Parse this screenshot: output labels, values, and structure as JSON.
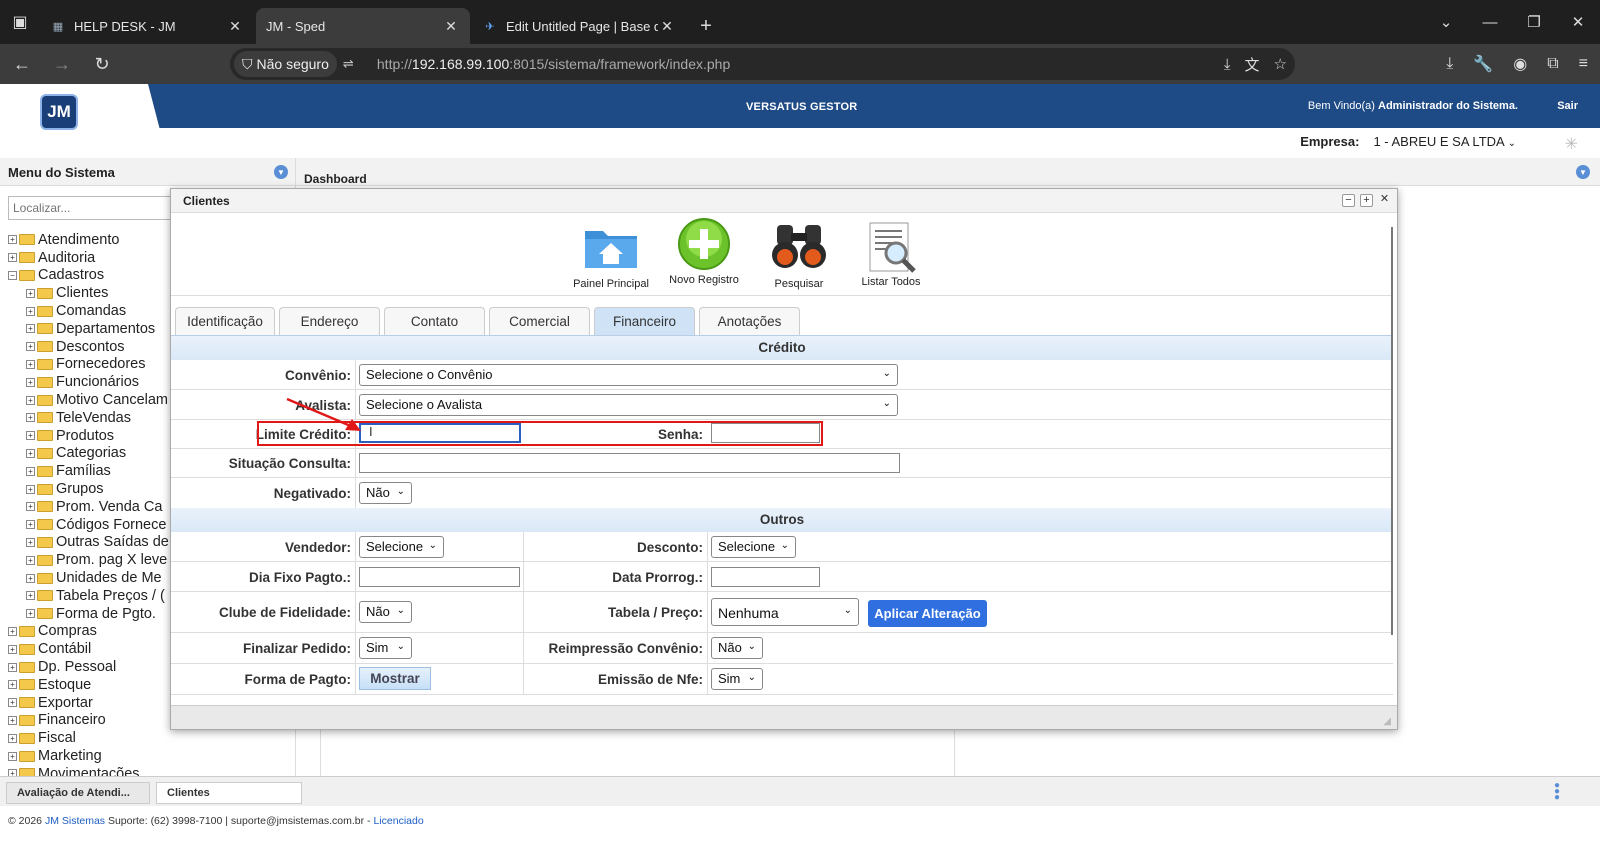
{
  "browser": {
    "tabs": [
      {
        "title": "HELP DESK - JM",
        "active": false
      },
      {
        "title": "JM - Sped",
        "active": true
      },
      {
        "title": "Edit Untitled Page | Base de Co",
        "active": false
      }
    ],
    "security_label": "Não seguro",
    "url_prefix": "http://",
    "url_host": "192.168.99.100",
    "url_rest": ":8015/sistema/framework/index.php"
  },
  "app": {
    "logo": "JM",
    "title": "VERSATUS GESTOR",
    "welcome_prefix": "Bem Vindo(a)",
    "welcome_user": "Administrador do Sistema.",
    "logout": "Sair",
    "company_label": "Empresa:",
    "company_value": "1 - ABREU E SA LTDA"
  },
  "menu": {
    "title": "Menu do Sistema",
    "search_placeholder": "Localizar...",
    "items": [
      {
        "label": "Atendimento",
        "level": 1,
        "sign": "+"
      },
      {
        "label": "Auditoria",
        "level": 1,
        "sign": "+"
      },
      {
        "label": "Cadastros",
        "level": 1,
        "sign": "−"
      },
      {
        "label": "Clientes",
        "level": 2,
        "sign": "+"
      },
      {
        "label": "Comandas",
        "level": 2,
        "sign": "+"
      },
      {
        "label": "Departamentos",
        "level": 2,
        "sign": "+"
      },
      {
        "label": "Descontos",
        "level": 2,
        "sign": "+"
      },
      {
        "label": "Fornecedores",
        "level": 2,
        "sign": "+"
      },
      {
        "label": "Funcionários",
        "level": 2,
        "sign": "+"
      },
      {
        "label": "Motivo Cancelam",
        "level": 2,
        "sign": "+"
      },
      {
        "label": "TeleVendas",
        "level": 2,
        "sign": "+"
      },
      {
        "label": "Produtos",
        "level": 2,
        "sign": "+"
      },
      {
        "label": "Categorias",
        "level": 2,
        "sign": "+"
      },
      {
        "label": "Famílias",
        "level": 2,
        "sign": "+"
      },
      {
        "label": "Grupos",
        "level": 2,
        "sign": "+"
      },
      {
        "label": "Prom. Venda Ca",
        "level": 2,
        "sign": "+"
      },
      {
        "label": "Códigos Fornece",
        "level": 2,
        "sign": "+"
      },
      {
        "label": "Outras Saídas de",
        "level": 2,
        "sign": "+"
      },
      {
        "label": "Prom. pag X leve",
        "level": 2,
        "sign": "+"
      },
      {
        "label": "Unidades de Me",
        "level": 2,
        "sign": "+"
      },
      {
        "label": "Tabela Preços / (",
        "level": 2,
        "sign": "+"
      },
      {
        "label": "Forma de Pgto.",
        "level": 2,
        "sign": "+"
      },
      {
        "label": "Compras",
        "level": 1,
        "sign": "+"
      },
      {
        "label": "Contábil",
        "level": 1,
        "sign": "+"
      },
      {
        "label": "Dp. Pessoal",
        "level": 1,
        "sign": "+"
      },
      {
        "label": "Estoque",
        "level": 1,
        "sign": "+"
      },
      {
        "label": "Exportar",
        "level": 1,
        "sign": "+"
      },
      {
        "label": "Financeiro",
        "level": 1,
        "sign": "+"
      },
      {
        "label": "Fiscal",
        "level": 1,
        "sign": "+"
      },
      {
        "label": "Marketing",
        "level": 1,
        "sign": "+"
      },
      {
        "label": "Movimentações",
        "level": 1,
        "sign": "+"
      }
    ]
  },
  "dashboard": {
    "title": "Dashboard"
  },
  "window": {
    "title": "Clientes",
    "toolbar": {
      "home": "Painel Principal",
      "new": "Novo Registro",
      "search": "Pesquisar",
      "list": "Listar Todos"
    },
    "tabs": [
      "Identificação",
      "Endereço",
      "Contato",
      "Comercial",
      "Financeiro",
      "Anotações"
    ],
    "active_tab": "Financeiro",
    "credito": {
      "title": "Crédito",
      "convenio_label": "Convênio:",
      "convenio_value": "Selecione o Convênio",
      "avalista_label": "Avalista:",
      "avalista_value": "Selecione o Avalista",
      "limite_label": "Limite Crédito:",
      "senha_label": "Senha:",
      "situacao_label": "Situação Consulta:",
      "negativado_label": "Negativado:",
      "negativado_value": "Não"
    },
    "outros": {
      "title": "Outros",
      "vendedor_label": "Vendedor:",
      "vendedor_value": "Selecione",
      "desconto_label": "Desconto:",
      "desconto_value": "Selecione",
      "diafixo_label": "Dia Fixo Pagto.:",
      "prorrog_label": "Data Prorrog.:",
      "clube_label": "Clube de Fidelidade:",
      "clube_value": "Não",
      "tabela_label": "Tabela / Preço:",
      "tabela_value": "Nenhuma",
      "aplicar_label": "Aplicar Alteração",
      "finalizar_label": "Finalizar Pedido:",
      "finalizar_value": "Sim",
      "reimp_label": "Reimpressão Convênio:",
      "reimp_value": "Não",
      "forma_label": "Forma de Pagto:",
      "mostrar_label": "Mostrar",
      "nfe_label": "Emissão de Nfe:",
      "nfe_value": "Sim"
    }
  },
  "taskbar": {
    "items": [
      "Avaliação de Atendi...",
      "Clientes"
    ]
  },
  "footer": {
    "copyright": "© 2026",
    "company_link": "JM Sistemas",
    "support": "Suporte: (62) 3998-7100 | suporte@jmsistemas.com.br -",
    "license_link": "Licenciado"
  },
  "colors": {
    "header_blue": "#1e4a86",
    "accent": "#2f6fe0",
    "highlight": "#e01818"
  }
}
